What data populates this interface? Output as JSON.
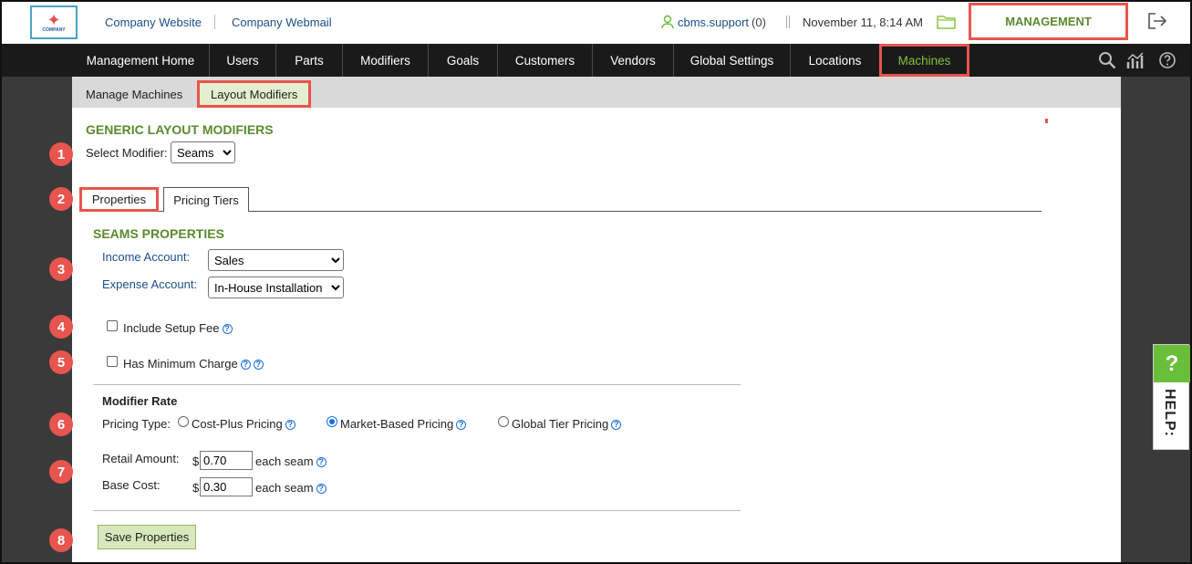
{
  "header": {
    "logo_text": "COMPANY",
    "links": [
      "Company Website",
      "Company Webmail"
    ],
    "user": "cbms.support",
    "user_count": "(0)",
    "date": "November 11, 8:14 AM",
    "management_label": "MANAGEMENT"
  },
  "nav": {
    "items": [
      "Management Home",
      "Users",
      "Parts",
      "Modifiers",
      "Goals",
      "Customers",
      "Vendors",
      "Global Settings",
      "Locations",
      "Machines"
    ],
    "active": "Machines"
  },
  "subnav": {
    "items": [
      "Manage Machines",
      "Layout Modifiers"
    ],
    "active": "Layout Modifiers"
  },
  "page": {
    "title": "GENERIC LAYOUT MODIFIERS",
    "select_modifier_label": "Select Modifier:",
    "select_modifier_value": "Seams",
    "tabs": [
      "Properties",
      "Pricing Tiers"
    ],
    "section_title": "SEAMS PROPERTIES",
    "income_account_label": "Income Account:",
    "income_account_value": "Sales",
    "expense_account_label": "Expense Account:",
    "expense_account_value": "In-House Installation",
    "include_setup_fee_label": "Include Setup Fee",
    "has_minimum_charge_label": "Has Minimum Charge",
    "modifier_rate_label": "Modifier Rate",
    "pricing_type_label": "Pricing Type:",
    "pricing_options": [
      "Cost-Plus Pricing",
      "Market-Based Pricing",
      "Global Tier Pricing"
    ],
    "pricing_selected": "Market-Based Pricing",
    "retail_amount_label": "Retail Amount:",
    "retail_amount_value": "0.70",
    "base_cost_label": "Base Cost:",
    "base_cost_value": "0.30",
    "currency_symbol": "$",
    "unit_label": "each seam",
    "save_label": "Save Properties"
  },
  "steps": [
    "1",
    "2",
    "3",
    "4",
    "5",
    "6",
    "7",
    "8"
  ],
  "help": {
    "icon": "?",
    "label": "HELP:"
  },
  "colors": {
    "accent_green": "#5b8a2e",
    "highlight_red": "#e8544e",
    "nav_bg": "#1a1a1a",
    "link_blue": "#1b4f8c"
  }
}
